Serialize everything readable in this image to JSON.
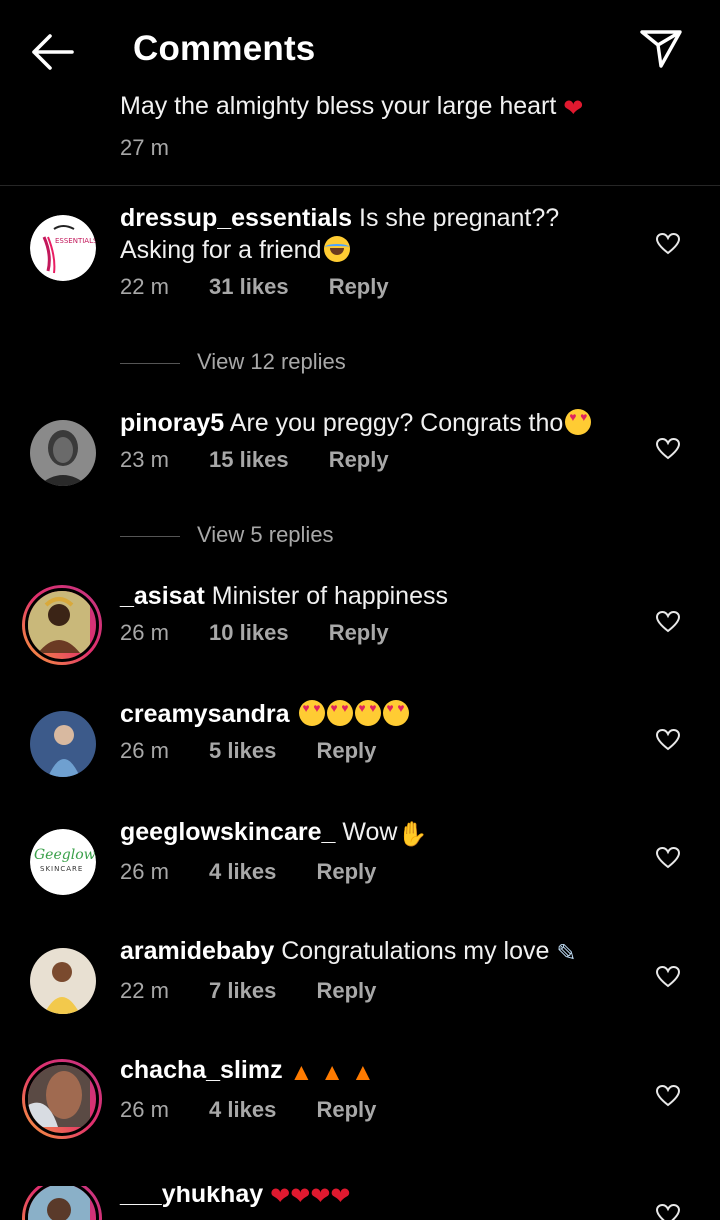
{
  "header": {
    "title": "Comments"
  },
  "top_comment": {
    "text": "May the almighty bless your large heart",
    "time": "27 m"
  },
  "comments": [
    {
      "user": "dressup_essentials",
      "text1": "Is she pregnant??",
      "text2": "Asking for a friend",
      "time": "22 m",
      "likes": "31 likes",
      "reply": "Reply"
    },
    {
      "user": "pinoray5",
      "text1": "Are you preggy? Congrats tho",
      "time": "23 m",
      "likes": "15 likes",
      "reply": "Reply"
    },
    {
      "user": "_asisat",
      "text1": "Minister of happiness",
      "time": "26 m",
      "likes": "10 likes",
      "reply": "Reply"
    },
    {
      "user": "creamysandra",
      "text1": "",
      "time": "26 m",
      "likes": "5 likes",
      "reply": "Reply"
    },
    {
      "user": "geeglowskincare_",
      "text1": "Wow",
      "time": "26 m",
      "likes": "4 likes",
      "reply": "Reply"
    },
    {
      "user": "aramidebaby",
      "text1": "Congratulations my love",
      "time": "22 m",
      "likes": "7 likes",
      "reply": "Reply"
    },
    {
      "user": "chacha_slimz",
      "text1": "",
      "time": "26 m",
      "likes": "4 likes",
      "reply": "Reply"
    },
    {
      "user": "___yhukhay",
      "text1": ""
    }
  ],
  "view_replies": [
    "View 12 replies",
    "View 5 replies"
  ],
  "avatars": {
    "dressup_essentials": "ESSENTIALS",
    "geeglowskincare_": {
      "brand": "Geeglow",
      "sub": "SKINCARE"
    }
  },
  "colors": {
    "background": "#000000",
    "meta": "#a8a8a8",
    "story_ring": "#e1306c"
  },
  "icons": [
    "back-arrow-icon",
    "send-icon",
    "heart-outline-icon"
  ]
}
